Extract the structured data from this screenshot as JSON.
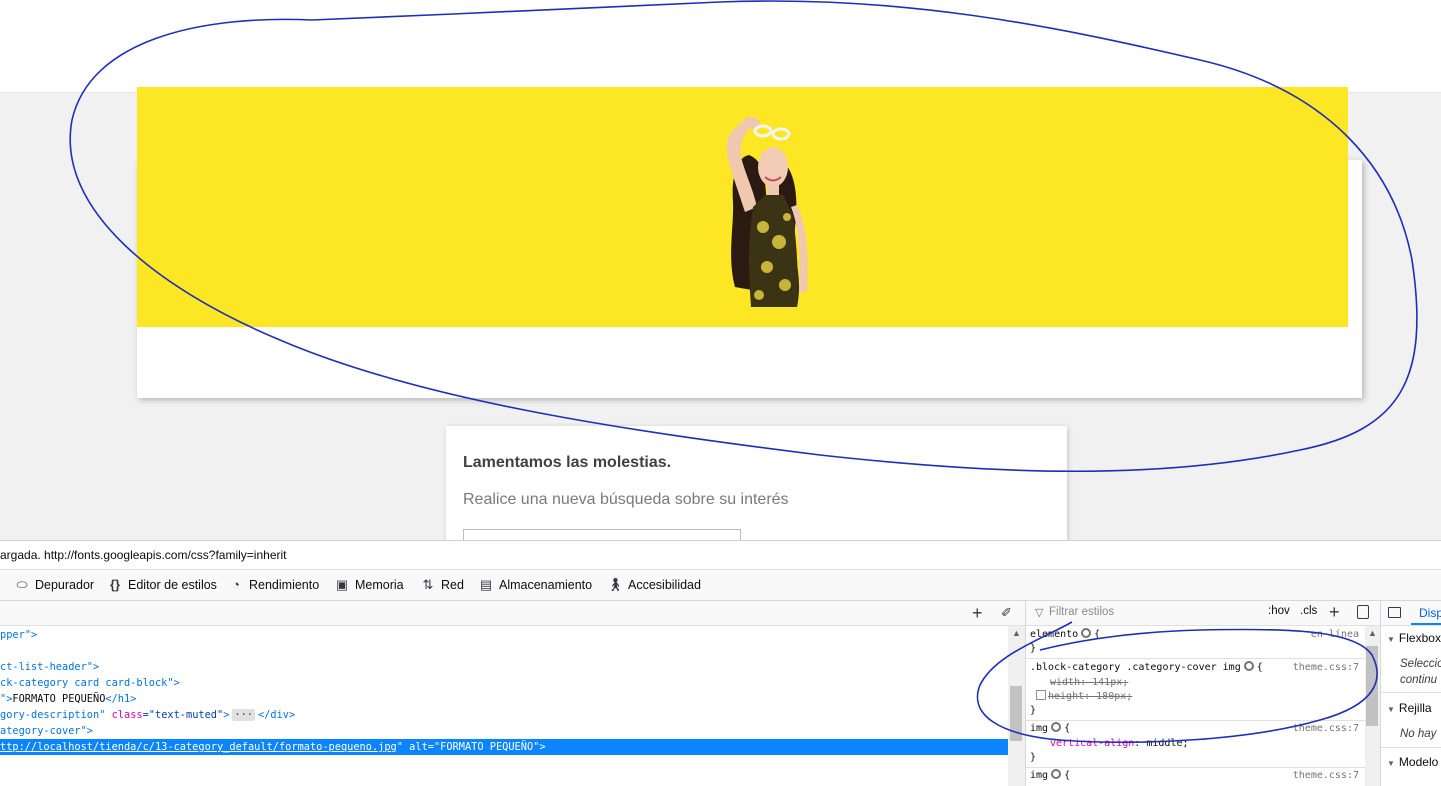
{
  "page": {
    "notfound_title": "Lamentamos las molestias.",
    "notfound_subtitle": "Realice una nueva búsqueda sobre su interés"
  },
  "console": {
    "message": "argada. http://fonts.googleapis.com/css?family=inherit"
  },
  "devtools": {
    "tabs": [
      {
        "label": "Depurador",
        "icon": "debugger-icon"
      },
      {
        "label": "Editor de estilos",
        "icon": "braces-icon"
      },
      {
        "label": "Rendimiento",
        "icon": "gauge-icon"
      },
      {
        "label": "Memoria",
        "icon": "chip-icon"
      },
      {
        "label": "Red",
        "icon": "arrows-updown-icon"
      },
      {
        "label": "Almacenamiento",
        "icon": "storage-icon"
      },
      {
        "label": "Accesibilidad",
        "icon": "accessibility-icon"
      }
    ],
    "markup": {
      "l1": "pper\">",
      "l2": "ct-list-header\">",
      "l3": "ck-category card card-block\">",
      "l4_a": "\">",
      "l4_text": "FORMATO PEQUEÑO",
      "l4_b": "</h1>",
      "l5_a": "gory-description\" ",
      "l5_attr": "class",
      "l5_val": "=\"text-muted\"",
      "l5_b": ">",
      "l5_ellipsis": "···",
      "l5_c": "</div>",
      "l6": "ategory-cover\">",
      "l7_link": "ttp://localhost/tienda/c/13-category_default/formato-pequeno.jpg",
      "l7_rest": "\" alt=\"FORMATO PEQUEÑO\">"
    },
    "rules": {
      "filter_placeholder": "Filtrar estilos",
      "hov": ":hov",
      "cls": ".cls",
      "r1_selector": "elemento",
      "r1_src": "en línea",
      "r2_selector": ".block-category .category-cover img",
      "r2_src": "theme.css:7",
      "r2_p1": "width: 141px;",
      "r2_p2": "height: 180px;",
      "r3_selector": "img",
      "r3_src": "theme.css:7",
      "r3_prop": "vertical-align",
      "r3_val": "middle",
      "r4_selector": "img",
      "r4_src": "theme.css:7",
      "open_brace": "{",
      "close_brace": "}"
    },
    "layout": {
      "tab": "Disp",
      "flexbox": "Flexbox",
      "flex_note1": "Seleccio",
      "flex_note2": "continu",
      "grid": "Rejilla",
      "grid_note": "No hay",
      "boxmodel": "Modelo"
    }
  },
  "colors": {
    "cover_yellow": "#fde725",
    "selection_blue": "#0a84ff",
    "annotation_ink": "#1d2fb8"
  }
}
